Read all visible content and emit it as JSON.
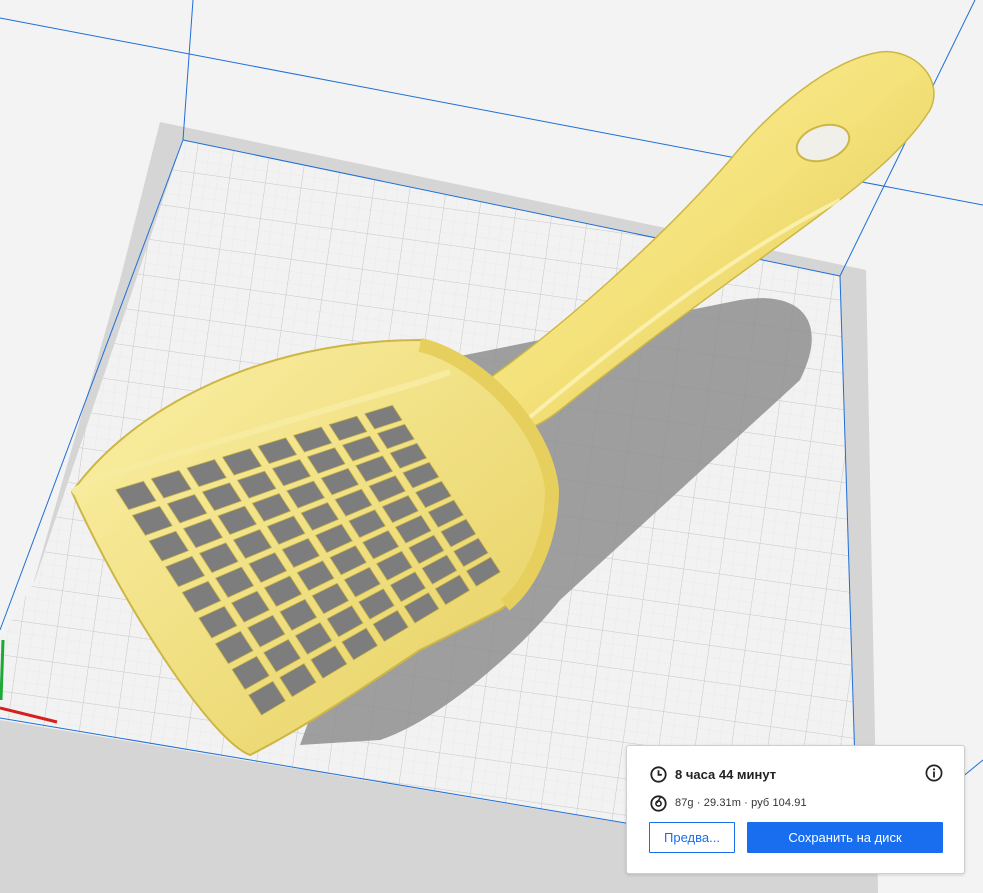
{
  "print_info": {
    "time_label": "8 часа 44 минут",
    "material_label": "87g · 29.31m · руб 104.91"
  },
  "buttons": {
    "preview_label": "Предва...",
    "save_label": "Сохранить на диск"
  },
  "icons": {
    "time": "clock-icon",
    "material": "spool-icon",
    "info": "info-icon"
  },
  "colors": {
    "model": "#f4e27a",
    "model_shade": "#d9c24c",
    "build_plate": "#f0f0f0",
    "grid": "#d4d4d4",
    "build_volume_line": "#1f6fd6",
    "primary_button": "#196ef0",
    "axis_x": "#d61f1f",
    "axis_y": "#1ea838"
  }
}
